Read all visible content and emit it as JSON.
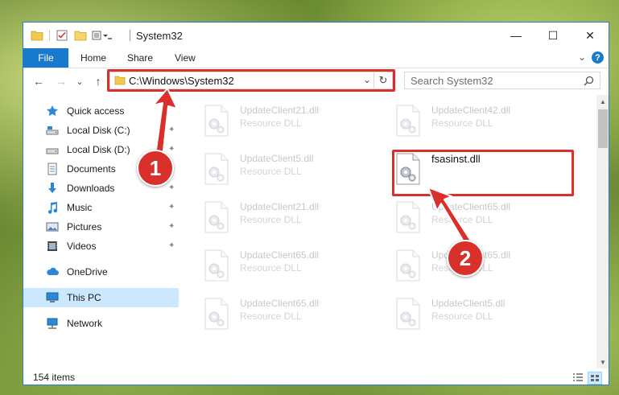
{
  "window": {
    "title": "System32",
    "controls": {
      "minimize": "—",
      "maximize": "☐",
      "close": "✕"
    }
  },
  "ribbon": {
    "file": "File",
    "tabs": [
      "Home",
      "Share",
      "View"
    ],
    "expand": "⌄",
    "help": "?"
  },
  "navigation": {
    "back": "←",
    "forward": "→",
    "recent": "⌄",
    "up": "↑",
    "address": "C:\\Windows\\System32",
    "address_dropdown": "⌄",
    "refresh": "↻",
    "search_placeholder": "Search System32"
  },
  "sidebar": {
    "items": [
      {
        "label": "Quick access",
        "icon": "star-icon",
        "pinned": false
      },
      {
        "label": "Local Disk (C:)",
        "icon": "drive-icon",
        "pinned": true
      },
      {
        "label": "Local Disk (D:)",
        "icon": "drive-icon",
        "pinned": true
      },
      {
        "label": "Documents",
        "icon": "documents-icon",
        "pinned": true
      },
      {
        "label": "Downloads",
        "icon": "download-icon",
        "pinned": true
      },
      {
        "label": "Music",
        "icon": "music-icon",
        "pinned": true
      },
      {
        "label": "Pictures",
        "icon": "pictures-icon",
        "pinned": true
      },
      {
        "label": "Videos",
        "icon": "videos-icon",
        "pinned": true
      },
      {
        "label": "OneDrive",
        "icon": "cloud-icon",
        "pinned": false
      },
      {
        "label": "This PC",
        "icon": "computer-icon",
        "pinned": false,
        "selected": true
      },
      {
        "label": "Network",
        "icon": "network-icon",
        "pinned": false
      }
    ],
    "pin_glyph": "📌"
  },
  "files": [
    {
      "name": "UpdateClient21.dll",
      "type": "Resource DLL"
    },
    {
      "name": "UpdateClient42.dll",
      "type": "Resource DLL"
    },
    {
      "name": "UpdateClient5.dll",
      "type": "Resource DLL"
    },
    {
      "name": "fsasinst.dll",
      "type": "",
      "highlighted": true
    },
    {
      "name": "UpdateClient21.dll",
      "type": "Resource DLL"
    },
    {
      "name": "UpdateClient65.dll",
      "type": "Resource DLL"
    },
    {
      "name": "UpdateClient65.dll",
      "type": "Resource DLL"
    },
    {
      "name": "UpdateClient65.dll",
      "type": "Resource DLL"
    },
    {
      "name": "UpdateClient65.dll",
      "type": "Resource DLL"
    },
    {
      "name": "UpdateClient5.dll",
      "type": "Resource DLL"
    }
  ],
  "status": {
    "item_count": "154 items"
  },
  "annotations": {
    "step1": "1",
    "step2": "2"
  },
  "colors": {
    "accent": "#1979ca",
    "highlight": "#d9302c",
    "selection": "#cce8ff"
  }
}
